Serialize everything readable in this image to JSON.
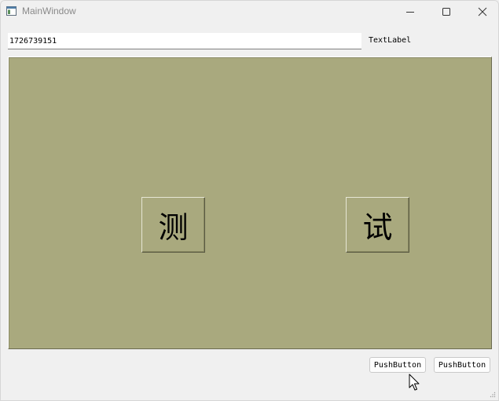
{
  "window": {
    "title": "MainWindow"
  },
  "input": {
    "value": "1726739151"
  },
  "label": {
    "text": "TextLabel"
  },
  "panel": {
    "background": "#a9a97e",
    "buttons": [
      {
        "label": "测"
      },
      {
        "label": "试"
      }
    ]
  },
  "footer": {
    "buttons": [
      {
        "label": "PushButton"
      },
      {
        "label": "PushButton"
      }
    ]
  },
  "icons": {
    "app": "window-app-icon",
    "minimize": "minimize-icon",
    "maximize": "maximize-icon",
    "close": "close-icon",
    "cursor": "mouse-cursor-icon",
    "grip": "resize-grip-icon"
  }
}
